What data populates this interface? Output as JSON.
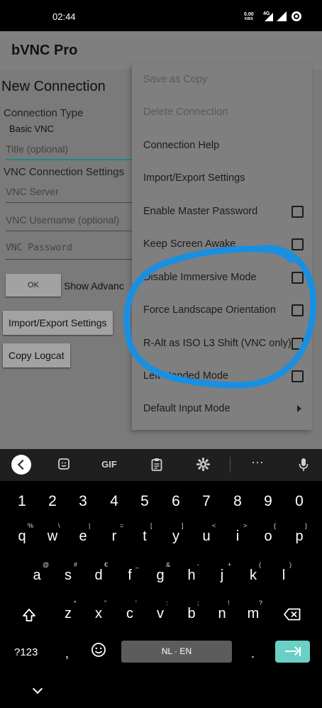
{
  "status_bar": {
    "time": "02:44",
    "net_speed": "0.00",
    "net_unit": "KB/S",
    "network_type": "4G"
  },
  "app": {
    "title": "bVNC Pro",
    "screen_title": "New Connection",
    "connection_type_label": "Connection Type",
    "connection_type_value": "Basic VNC",
    "title_placeholder": "Title (optional)",
    "vnc_settings_label": "VNC Connection Settings",
    "vnc_server_placeholder": "VNC Server",
    "vnc_username_placeholder": "VNC Username (optional)",
    "vnc_password_placeholder": "VNC Password",
    "ok_button": "OK",
    "show_advanced": "Show Advanc",
    "import_export_button": "Import/Export Settings",
    "copy_logcat_button": "Copy Logcat"
  },
  "menu": {
    "items": [
      {
        "label": "Save as Copy",
        "enabled": false,
        "has_checkbox": false
      },
      {
        "label": "Delete Connection",
        "enabled": false,
        "has_checkbox": false
      },
      {
        "label": "Connection Help",
        "enabled": true,
        "has_checkbox": false
      },
      {
        "label": "Import/Export Settings",
        "enabled": true,
        "has_checkbox": false
      },
      {
        "label": "Enable Master Password",
        "enabled": true,
        "has_checkbox": true,
        "checked": false
      },
      {
        "label": "Keep Screen Awake",
        "enabled": true,
        "has_checkbox": true,
        "checked": false
      },
      {
        "label": "Disable Immersive Mode",
        "enabled": true,
        "has_checkbox": true,
        "checked": false
      },
      {
        "label": "Force Landscape Orientation",
        "enabled": true,
        "has_checkbox": true,
        "checked": false
      },
      {
        "label": "R-Alt as ISO L3 Shift (VNC only)",
        "enabled": true,
        "has_checkbox": true,
        "checked": false
      },
      {
        "label": "Left-Handed Mode",
        "enabled": true,
        "has_checkbox": true,
        "checked": false
      },
      {
        "label": "Default Input Mode",
        "enabled": true,
        "has_checkbox": false,
        "submenu": true
      }
    ]
  },
  "annotation": {
    "color": "#1a8fe0"
  },
  "keyboard": {
    "toolbar": {
      "gif_label": "GIF",
      "icons": [
        "back-icon",
        "sticker-icon",
        "gif-icon",
        "clipboard-icon",
        "settings-icon",
        "more-icon",
        "mic-icon"
      ]
    },
    "number_row": [
      "1",
      "2",
      "3",
      "4",
      "5",
      "6",
      "7",
      "8",
      "9",
      "0"
    ],
    "row1": [
      {
        "key": "q",
        "sup": "%"
      },
      {
        "key": "w",
        "sup": "\\"
      },
      {
        "key": "e",
        "sup": "|"
      },
      {
        "key": "r",
        "sup": "="
      },
      {
        "key": "t",
        "sup": "["
      },
      {
        "key": "y",
        "sup": "]"
      },
      {
        "key": "u",
        "sup": "<"
      },
      {
        "key": "i",
        "sup": ">"
      },
      {
        "key": "o",
        "sup": "{"
      },
      {
        "key": "p",
        "sup": "}"
      }
    ],
    "row2": [
      {
        "key": "a",
        "sup": "@"
      },
      {
        "key": "s",
        "sup": "#"
      },
      {
        "key": "d",
        "sup": "€"
      },
      {
        "key": "f",
        "sup": "_"
      },
      {
        "key": "g",
        "sup": "&"
      },
      {
        "key": "h",
        "sup": "-"
      },
      {
        "key": "j",
        "sup": "+"
      },
      {
        "key": "k",
        "sup": "("
      },
      {
        "key": "l",
        "sup": ")"
      }
    ],
    "row3": [
      {
        "key": "z",
        "sup": "*"
      },
      {
        "key": "x",
        "sup": "\""
      },
      {
        "key": "c",
        "sup": "'"
      },
      {
        "key": "v",
        "sup": ":"
      },
      {
        "key": "b",
        "sup": ";"
      },
      {
        "key": "n",
        "sup": "!"
      },
      {
        "key": "m",
        "sup": "?"
      }
    ],
    "symbols_key": "?123",
    "comma_key": ",",
    "period_key": ".",
    "space_label": "NL · EN"
  }
}
